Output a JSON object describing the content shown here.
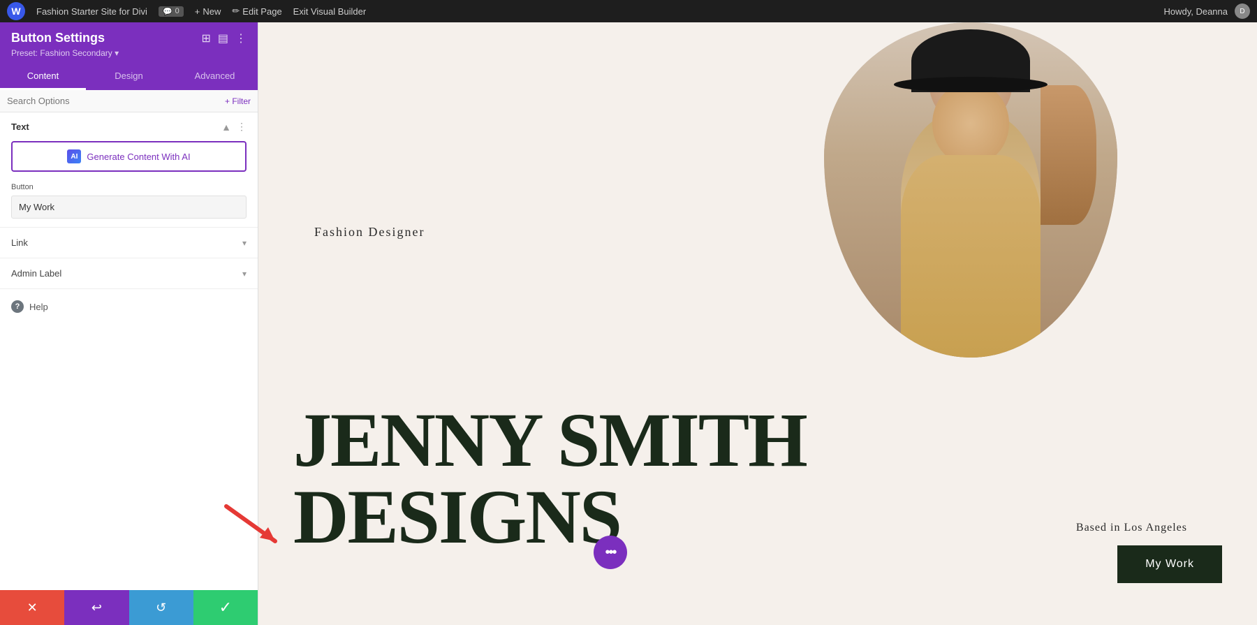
{
  "adminBar": {
    "siteName": "Fashion Starter Site for Divi",
    "commentCount": "0",
    "newLabel": "New",
    "editPageLabel": "Edit Page",
    "exitVBLabel": "Exit Visual Builder",
    "howdy": "Howdy, Deanna"
  },
  "panel": {
    "title": "Button Settings",
    "preset": "Preset: Fashion Secondary ▾",
    "tabs": [
      "Content",
      "Design",
      "Advanced"
    ],
    "activeTab": "Content",
    "searchPlaceholder": "Search Options",
    "filterLabel": "+ Filter"
  },
  "sections": {
    "text": {
      "title": "Text",
      "aiButtonLabel": "Generate Content With AI",
      "buttonFieldLabel": "Button",
      "buttonValue": "My Work"
    },
    "link": {
      "title": "Link"
    },
    "adminLabel": {
      "title": "Admin Label"
    }
  },
  "help": {
    "label": "Help"
  },
  "bottomBar": {
    "cancelLabel": "✕",
    "undoLabel": "↩",
    "redoLabel": "↺",
    "saveLabel": "✓"
  },
  "canvas": {
    "fashionLabel": "Fashion Designer",
    "heroNameLine1": "JENNY SMITH",
    "heroNameLine2": "DESIGNS",
    "basedIn": "Based in Los Angeles",
    "myWorkBtn": "My Work",
    "dotsLabel": "•••"
  }
}
